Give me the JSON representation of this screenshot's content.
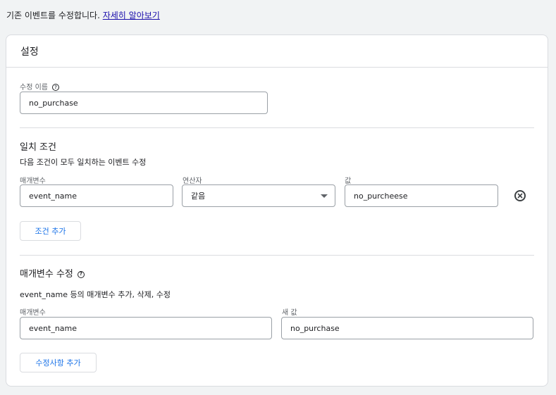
{
  "intro": {
    "text": "기존 이벤트를 수정합니다.",
    "link": "자세히 알아보기"
  },
  "card": {
    "title": "설정",
    "modification_name": {
      "label": "수정 이름",
      "value": "no_purchase"
    },
    "matching_conditions": {
      "title": "일치 조건",
      "description": "다음 조건이 모두 일치하는 이벤트 수정",
      "headers": {
        "parameter": "매개변수",
        "operator": "연산자",
        "value": "값"
      },
      "rows": [
        {
          "parameter": "event_name",
          "operator": "같음",
          "value": "no_purcheese"
        }
      ],
      "add_button": "조건 추가"
    },
    "parameter_modification": {
      "title": "매개변수 수정",
      "description": "event_name 등의 매개변수 추가, 삭제, 수정",
      "headers": {
        "parameter": "매개변수",
        "new_value": "새 값"
      },
      "rows": [
        {
          "parameter": "event_name",
          "new_value": "no_purchase"
        }
      ],
      "add_button": "수정사항 추가"
    }
  },
  "icons": {
    "help": "help-icon",
    "remove": "remove-circle-icon",
    "dropdown": "dropdown-arrow-icon"
  },
  "colors": {
    "link": "#1a0dab",
    "button_text": "#1a73e8",
    "border": "#dadce0",
    "input_border": "#9aa0a6"
  }
}
